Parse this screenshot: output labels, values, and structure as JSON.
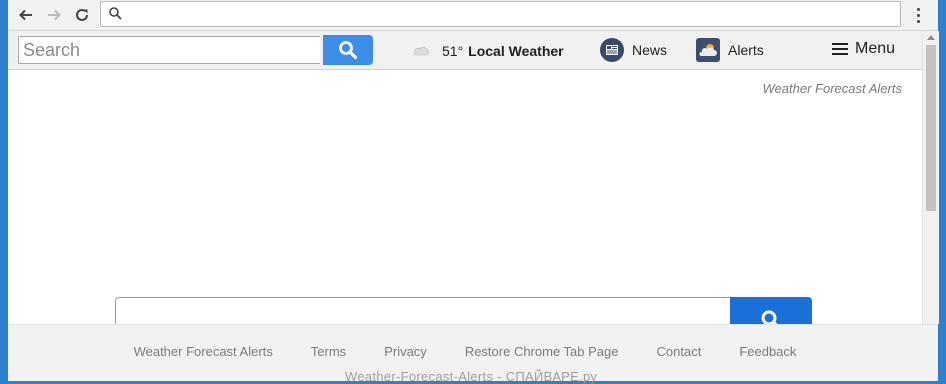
{
  "toolbar": {
    "search_placeholder": "Search",
    "weather_temp": "51°",
    "weather_label": "Local Weather",
    "news_label": "News",
    "alerts_label": "Alerts",
    "menu_label": "Menu"
  },
  "main": {
    "brand": "Weather Forecast Alerts"
  },
  "footer": {
    "links": [
      "Weather Forecast Alerts",
      "Terms",
      "Privacy",
      "Restore Chrome Tab Page",
      "Contact",
      "Feedback"
    ],
    "watermark": "Weather-Forecast-Alerts - СПАЙВАРЕ.ру"
  },
  "colors": {
    "frame": "#2f7fd2",
    "toolbar_search_button": "#3d8eea",
    "main_search_button": "#1a6fd9"
  },
  "icons": [
    "back-arrow-icon",
    "forward-arrow-icon",
    "reload-icon",
    "search-icon",
    "kebab-menu-icon",
    "cloud-icon",
    "news-icon",
    "alerts-icon",
    "hamburger-icon"
  ]
}
